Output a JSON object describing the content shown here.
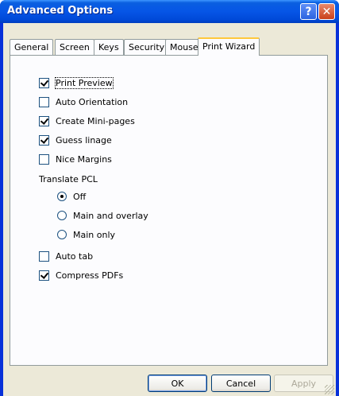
{
  "window": {
    "title": "Advanced Options"
  },
  "titlebar": {
    "help_glyph": "?",
    "close_glyph": "✕"
  },
  "tabs": [
    {
      "label": "General",
      "active": false
    },
    {
      "label": "Screen",
      "active": false
    },
    {
      "label": "Keys",
      "active": false
    },
    {
      "label": "Security",
      "active": false
    },
    {
      "label": "Mouse",
      "active": false
    },
    {
      "label": "Print Wizard",
      "active": true
    }
  ],
  "options": {
    "print_preview": {
      "label": "Print Preview",
      "checked": true
    },
    "auto_orientation": {
      "label": "Auto Orientation",
      "checked": false
    },
    "create_mini_pages": {
      "label": "Create Mini-pages",
      "checked": true
    },
    "guess_linage": {
      "label": "Guess linage",
      "checked": true
    },
    "nice_margins": {
      "label": "Nice Margins",
      "checked": false
    },
    "translate_pcl": {
      "label": "Translate PCL",
      "choices": [
        {
          "label": "Off",
          "selected": true
        },
        {
          "label": "Main and overlay",
          "selected": false
        },
        {
          "label": "Main only",
          "selected": false
        }
      ]
    },
    "auto_tab": {
      "label": "Auto tab",
      "checked": false
    },
    "compress_pdfs": {
      "label": "Compress PDFs",
      "checked": true
    }
  },
  "buttons": {
    "ok": "OK",
    "cancel": "Cancel",
    "apply": "Apply"
  }
}
